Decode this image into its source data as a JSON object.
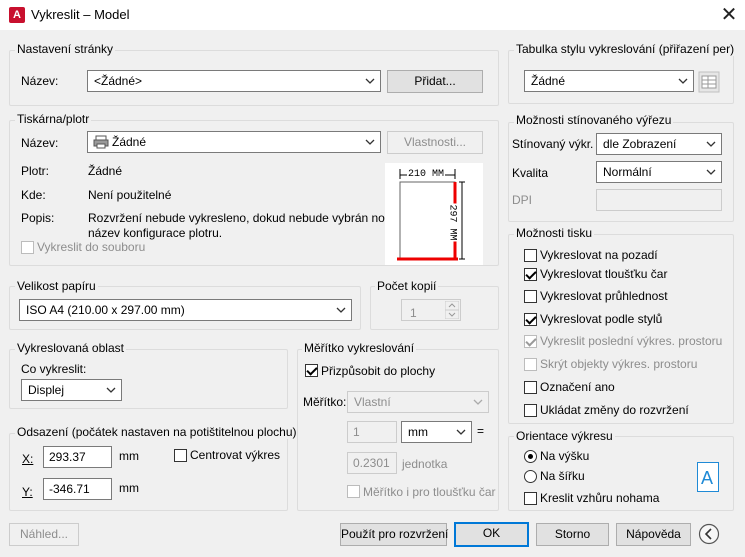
{
  "window": {
    "title": "Vykreslit – Model",
    "app_icon": "A",
    "close": "✕"
  },
  "page_setup": {
    "legend": "Nastavení stránky",
    "name_label": "Název:",
    "name_value": "<Žádné>",
    "add_button": "Přidat..."
  },
  "printer": {
    "legend": "Tiskárna/plotr",
    "name_label": "Název:",
    "name_value": "Žádné",
    "properties_button": "Vlastnosti...",
    "plotter_label": "Plotr:",
    "plotter_value": "Žádné",
    "where_label": "Kde:",
    "where_value": "Není použitelné",
    "desc_label": "Popis:",
    "desc_value_1": "Rozvržení nebude vykresleno, dokud nebude vybrán nový",
    "desc_value_2": "název konfigurace plotru.",
    "plot_to_file": "Vykreslit do souboru"
  },
  "preview": {
    "width_label": "210 MM",
    "height_label": "297 MM"
  },
  "paper_size": {
    "legend": "Velikost papíru",
    "value": "ISO A4 (210.00 x 297.00 mm)"
  },
  "copies": {
    "legend": "Počet kopií",
    "value": "1"
  },
  "plot_area": {
    "legend": "Vykreslovaná oblast",
    "what_label": "Co vykreslit:",
    "what_value": "Displej"
  },
  "plot_offset": {
    "legend": "Odsazení (počátek nastaven na potištitelnou plochu)",
    "x_label": "X:",
    "x_value": "293.37",
    "x_unit": "mm",
    "y_label": "Y:",
    "y_value": "-346.71",
    "y_unit": "mm",
    "center_label": "Centrovat výkres"
  },
  "plot_scale": {
    "legend": "Měřítko vykreslování",
    "fit_label": "Přizpůsobit do plochy",
    "scale_label": "Měřítko:",
    "scale_value": "Vlastní",
    "num_value": "1",
    "unit_value": "mm",
    "equals": "=",
    "unit_count": "0.2301",
    "unit_text": "jednotka",
    "lineweights_label": "Měřítko i pro tloušťku čar"
  },
  "style_table": {
    "legend": "Tabulka stylu vykreslování (přiřazení per)",
    "value": "Žádné"
  },
  "shaded": {
    "legend": "Možnosti stínovaného výřezu",
    "shade_label": "Stínovaný výkr.",
    "shade_value": "dle Zobrazení",
    "quality_label": "Kvalita",
    "quality_value": "Normální",
    "dpi_label": "DPI"
  },
  "plot_options": {
    "legend": "Možnosti tisku",
    "items": [
      {
        "label": "Vykreslovat na pozadí"
      },
      {
        "label": "Vykreslovat tloušťku čar"
      },
      {
        "label": "Vykreslovat průhlednost"
      },
      {
        "label": "Vykreslovat podle stylů"
      },
      {
        "label": "Vykreslit poslední výkres. prostoru"
      },
      {
        "label": "Skrýt objekty výkres. prostoru"
      },
      {
        "label": "Označení ano"
      },
      {
        "label": "Ukládat změny do rozvržení"
      }
    ]
  },
  "orientation": {
    "legend": "Orientace výkresu",
    "portrait": "Na výšku",
    "landscape": "Na šířku",
    "upside_down": "Kreslit vzhůru nohama",
    "icon_letter": "A"
  },
  "buttons": {
    "preview": "Náhled...",
    "apply": "Použít pro rozvržení",
    "ok": "OK",
    "cancel": "Storno",
    "help": "Nápověda"
  }
}
